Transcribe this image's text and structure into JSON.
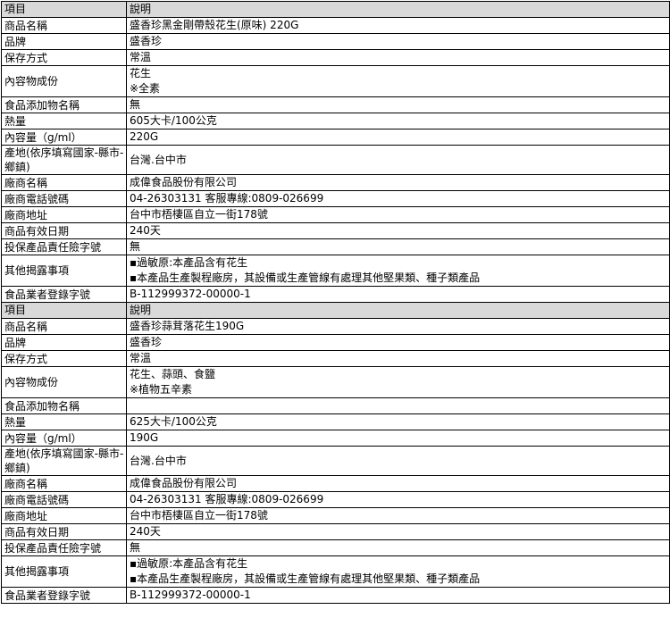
{
  "tables": [
    {
      "header": {
        "item": "項目",
        "desc": "說明"
      },
      "rows": [
        {
          "label": "商品名稱",
          "lines": [
            "盛香珍黑金剛帶殼花生(原味) 220G"
          ]
        },
        {
          "label": "品牌",
          "lines": [
            "盛香珍"
          ]
        },
        {
          "label": "保存方式",
          "lines": [
            "常溫"
          ]
        },
        {
          "label": "內容物成份",
          "lines": [
            "花生",
            "※全素"
          ]
        },
        {
          "label": "食品添加物名稱",
          "lines": [
            "無"
          ]
        },
        {
          "label": "熱量",
          "lines": [
            "605大卡/100公克"
          ]
        },
        {
          "label": "內容量（g/ml）",
          "lines": [
            "220G"
          ]
        },
        {
          "label": "產地(依序填寫國家-縣市-鄉鎮)",
          "lines": [
            "台灣.台中市"
          ]
        },
        {
          "label": "廠商名稱",
          "lines": [
            "成偉食品股份有限公司"
          ]
        },
        {
          "label": "廠商電話號碼",
          "lines": [
            "04-26303131  客服專線:0809-026699"
          ]
        },
        {
          "label": "廠商地址",
          "lines": [
            "台中市梧棲區自立一街178號"
          ]
        },
        {
          "label": "商品有效日期",
          "lines": [
            "240天"
          ]
        },
        {
          "label": "投保產品責任險字號",
          "lines": [
            "無"
          ]
        },
        {
          "label": "其他揭露事項",
          "lines": [
            "▪過敏原:本產品含有花生",
            "▪本產品生產製程廠房，其設備或生產管線有處理其他堅果類、種子類產品"
          ]
        },
        {
          "label": "食品業者登錄字號",
          "lines": [
            "B-112999372-00000-1"
          ]
        }
      ]
    },
    {
      "header": {
        "item": "項目",
        "desc": "說明"
      },
      "rows": [
        {
          "label": "商品名稱",
          "lines": [
            "盛香珍蒜茸落花生190G"
          ]
        },
        {
          "label": "品牌",
          "lines": [
            "盛香珍"
          ]
        },
        {
          "label": "保存方式",
          "lines": [
            "常溫"
          ]
        },
        {
          "label": "內容物成份",
          "lines": [
            "花生、蒜頭、食鹽",
            "※植物五辛素"
          ]
        },
        {
          "label": "食品添加物名稱",
          "lines": [
            ""
          ]
        },
        {
          "label": "熱量",
          "lines": [
            "625大卡/100公克"
          ]
        },
        {
          "label": "內容量（g/ml）",
          "lines": [
            "190G"
          ]
        },
        {
          "label": "產地(依序填寫國家-縣市-鄉鎮)",
          "lines": [
            "台灣.台中市"
          ]
        },
        {
          "label": "廠商名稱",
          "lines": [
            "成偉食品股份有限公司"
          ]
        },
        {
          "label": "廠商電話號碼",
          "lines": [
            "04-26303131  客服專線:0809-026699"
          ]
        },
        {
          "label": "廠商地址",
          "lines": [
            "台中市梧棲區自立一街178號"
          ]
        },
        {
          "label": "商品有效日期",
          "lines": [
            "240天"
          ]
        },
        {
          "label": "投保產品責任險字號",
          "lines": [
            "無"
          ]
        },
        {
          "label": "其他揭露事項",
          "lines": [
            "▪過敏原:本產品含有花生",
            "▪本產品生產製程廠房，其設備或生產管線有處理其他堅果類、種子類產品"
          ]
        },
        {
          "label": "食品業者登錄字號",
          "lines": [
            "B-112999372-00000-1"
          ]
        }
      ]
    }
  ]
}
